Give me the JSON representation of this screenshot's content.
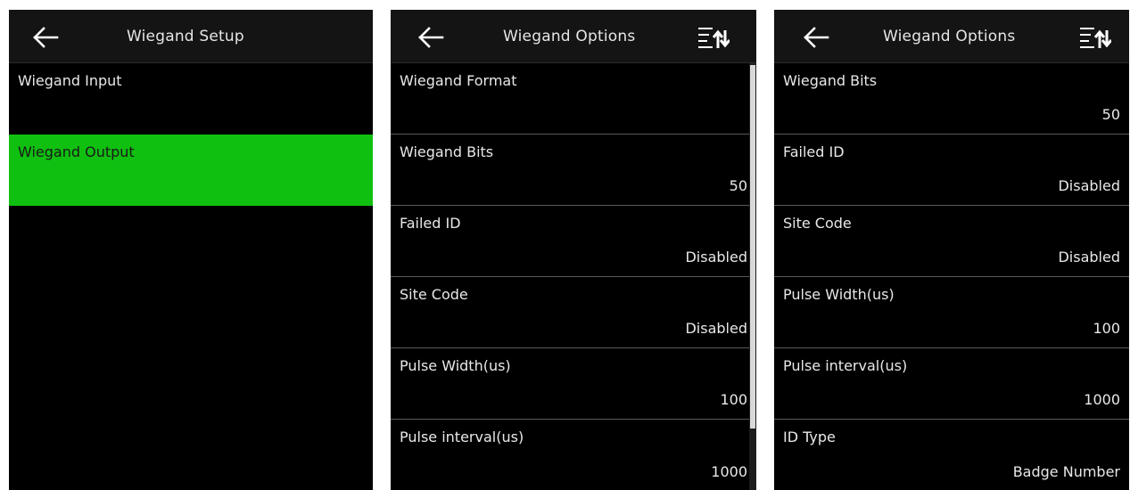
{
  "screen1": {
    "title": "Wiegand Setup",
    "items": [
      {
        "label": "Wiegand Input"
      },
      {
        "label": "Wiegand Output"
      }
    ],
    "selected_color": "#10c010"
  },
  "screen2": {
    "title": "Wiegand Options",
    "items": [
      {
        "label": "Wiegand Format",
        "value": ""
      },
      {
        "label": "Wiegand Bits",
        "value": "50"
      },
      {
        "label": "Failed ID",
        "value": "Disabled"
      },
      {
        "label": "Site Code",
        "value": "Disabled"
      },
      {
        "label": "Pulse Width(us)",
        "value": "100"
      },
      {
        "label": "Pulse interval(us)",
        "value": "1000"
      }
    ]
  },
  "screen3": {
    "title": "Wiegand Options",
    "items": [
      {
        "label": "Wiegand Bits",
        "value": "50"
      },
      {
        "label": "Failed ID",
        "value": "Disabled"
      },
      {
        "label": "Site Code",
        "value": "Disabled"
      },
      {
        "label": "Pulse Width(us)",
        "value": "100"
      },
      {
        "label": "Pulse interval(us)",
        "value": "1000"
      },
      {
        "label": "ID Type",
        "value": "Badge Number"
      }
    ]
  },
  "icons": {
    "back": "back-arrow-icon",
    "sort": "sort-icon"
  }
}
